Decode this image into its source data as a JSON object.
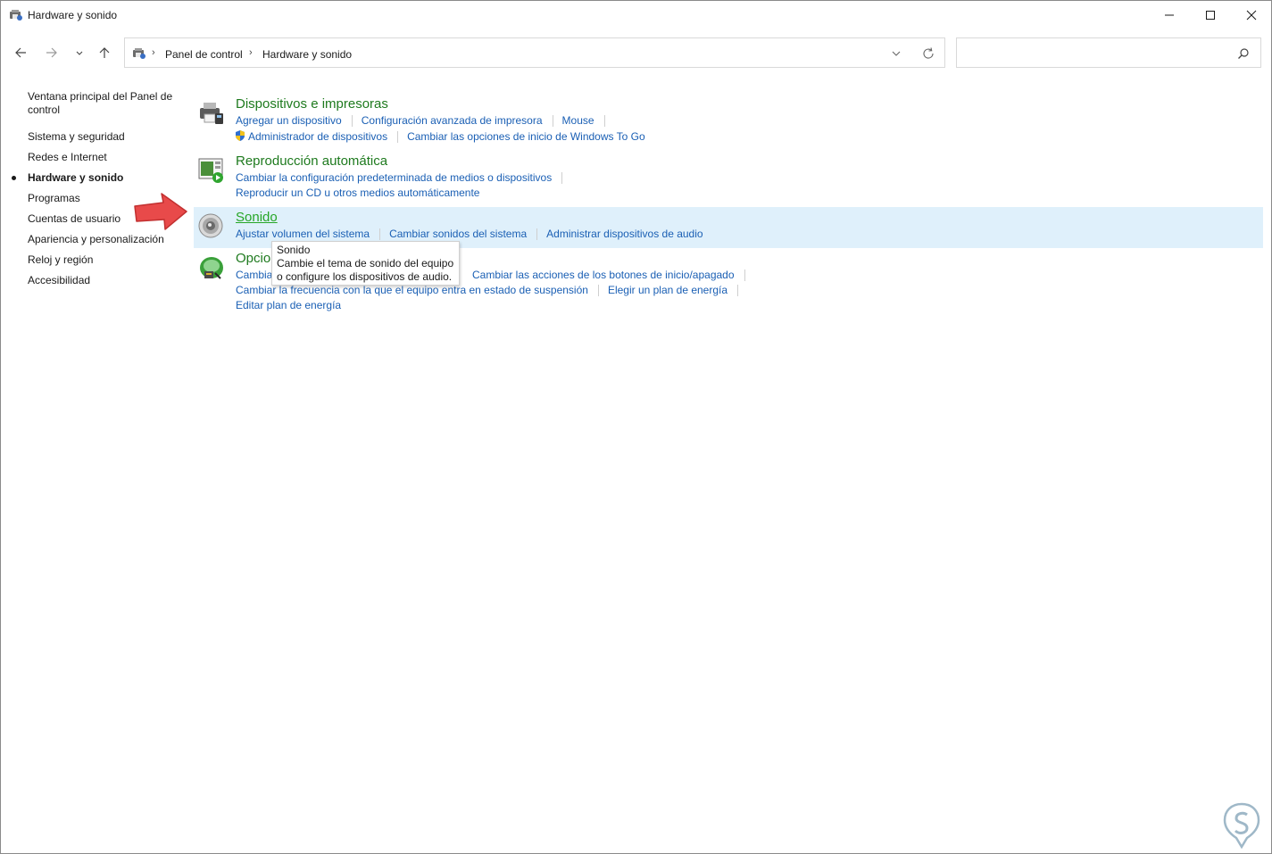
{
  "window": {
    "title": "Hardware y sonido",
    "controls": {
      "minimize": "minimize-icon",
      "maximize": "maximize-icon",
      "close": "close-icon"
    }
  },
  "address": {
    "crumbs": [
      "Panel de control",
      "Hardware y sonido"
    ],
    "search_placeholder": ""
  },
  "sidebar": {
    "items": [
      {
        "label": "Ventana principal del Panel de control",
        "active": false
      },
      {
        "label": "Sistema y seguridad",
        "active": false
      },
      {
        "label": "Redes e Internet",
        "active": false
      },
      {
        "label": "Hardware y sonido",
        "active": true
      },
      {
        "label": "Programas",
        "active": false
      },
      {
        "label": "Cuentas de usuario",
        "active": false
      },
      {
        "label": "Apariencia y personalización",
        "active": false
      },
      {
        "label": "Reloj y región",
        "active": false
      },
      {
        "label": "Accesibilidad",
        "active": false
      }
    ]
  },
  "categories": [
    {
      "title": "Dispositivos e impresoras",
      "icon": "printer-device-icon",
      "rows": [
        [
          "Agregar un dispositivo",
          "Configuración avanzada de impresora",
          "Mouse"
        ],
        [
          "Administrador de dispositivos",
          "Cambiar las opciones de inicio de Windows To Go"
        ]
      ]
    },
    {
      "title": "Reproducción automática",
      "icon": "autoplay-icon",
      "rows": [
        [
          "Cambiar la configuración predeterminada de medios o dispositivos"
        ],
        [
          "Reproducir un CD u otros medios automáticamente"
        ]
      ]
    },
    {
      "title": "Sonido",
      "icon": "speaker-icon",
      "rows": [
        [
          "Ajustar volumen del sistema",
          "Cambiar sonidos del sistema",
          "Administrar dispositivos de audio"
        ]
      ]
    },
    {
      "title": "Opcio",
      "icon": "power-options-icon",
      "rows": [
        [
          "Cambia",
          "Cambiar las acciones de los botones de inicio/apagado"
        ],
        [
          "Cambiar la frecuencia con la que el equipo entra en estado de suspensión",
          "Elegir un plan de energía"
        ],
        [
          "Editar plan de energía"
        ]
      ]
    }
  ],
  "tooltip": {
    "title": "Sonido",
    "line1": "Cambie el tema de sonido del equipo",
    "line2": "o configure los dispositivos de audio."
  },
  "colors": {
    "category_title": "#1e7a1e",
    "link": "#1a5fb4",
    "hover_bg": "#dff0fb",
    "annotation_arrow": "#e84a4a"
  }
}
